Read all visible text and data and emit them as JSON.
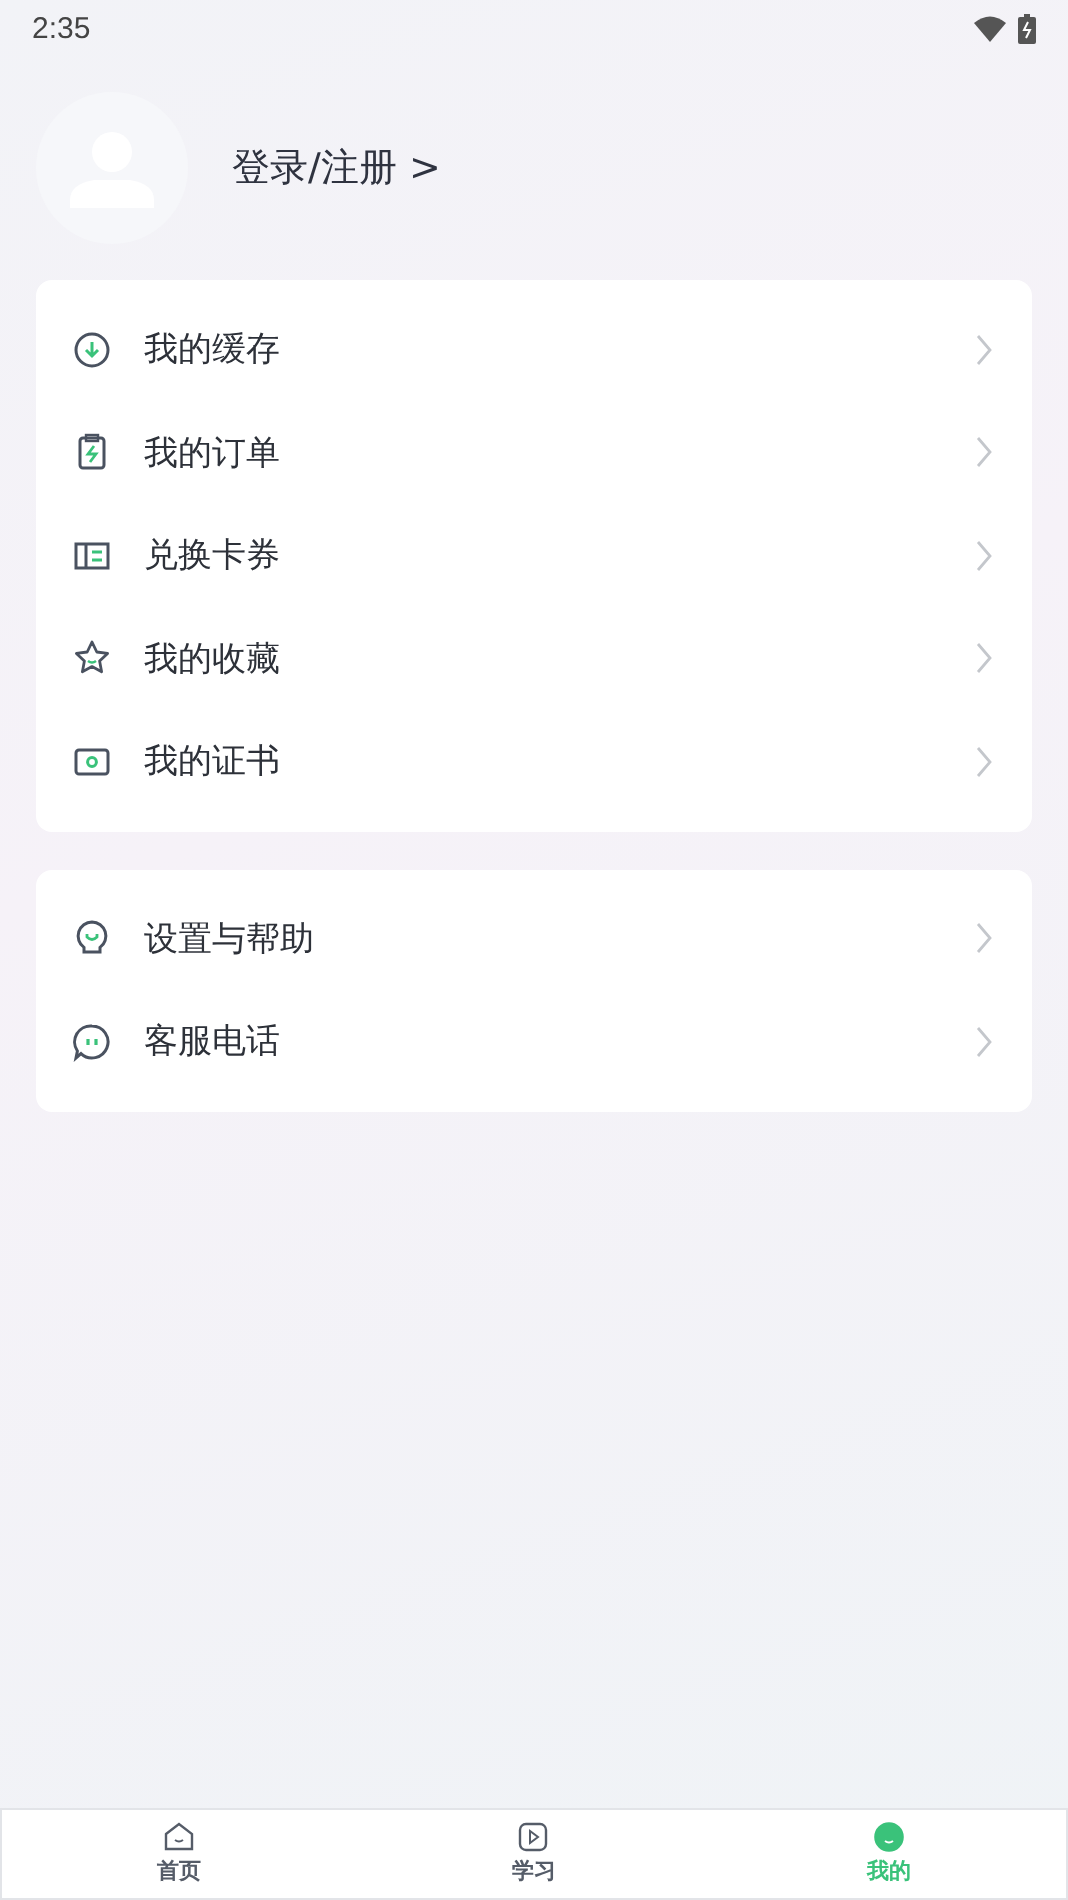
{
  "status_bar": {
    "time": "2:35"
  },
  "profile": {
    "login_label": "登录/注册 >"
  },
  "menu_groups": [
    {
      "items": [
        {
          "label": "我的缓存"
        },
        {
          "label": "我的订单"
        },
        {
          "label": "兑换卡券"
        },
        {
          "label": "我的收藏"
        },
        {
          "label": "我的证书"
        }
      ]
    },
    {
      "items": [
        {
          "label": "设置与帮助"
        },
        {
          "label": "客服电话"
        }
      ]
    }
  ],
  "tab_bar": [
    {
      "label": "首页",
      "selected": false
    },
    {
      "label": "学习",
      "selected": false
    },
    {
      "label": "我的",
      "selected": true
    }
  ]
}
